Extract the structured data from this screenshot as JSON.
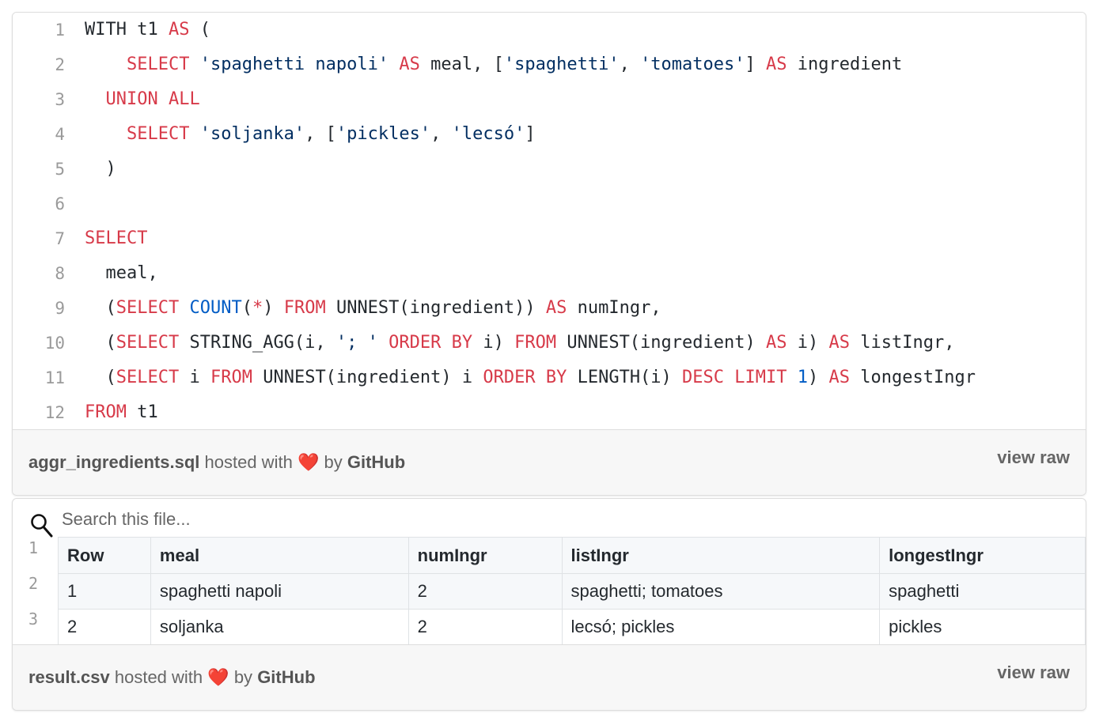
{
  "gist1": {
    "line_numbers": [
      "1",
      "2",
      "3",
      "4",
      "5",
      "6",
      "7",
      "8",
      "9",
      "10",
      "11",
      "12"
    ],
    "filename": "aggr_ingredients.sql",
    "hosted_with": "hosted with",
    "heart": "❤️",
    "by": "by",
    "github": "GitHub",
    "view_raw": "view raw"
  },
  "gist2": {
    "search_placeholder": "Search this file...",
    "line_numbers": [
      "1",
      "2",
      "3"
    ],
    "headers": [
      "Row",
      "meal",
      "numIngr",
      "listIngr",
      "longestIngr"
    ],
    "rows": [
      [
        "1",
        "spaghetti napoli",
        "2",
        "spaghetti; tomatoes",
        "spaghetti"
      ],
      [
        "2",
        "soljanka",
        "2",
        "lecsó; pickles",
        "pickles"
      ]
    ],
    "filename": "result.csv",
    "hosted_with": "hosted with",
    "heart": "❤️",
    "by": "by",
    "github": "GitHub",
    "view_raw": "view raw"
  },
  "colors": {
    "keyword": "#d73a49",
    "function": "#005cc5",
    "string": "#032f62",
    "line_number": "#9a9a9a",
    "footer_bg": "#f7f7f7"
  },
  "icons": {
    "search": "search-icon",
    "heart": "heart-icon"
  }
}
